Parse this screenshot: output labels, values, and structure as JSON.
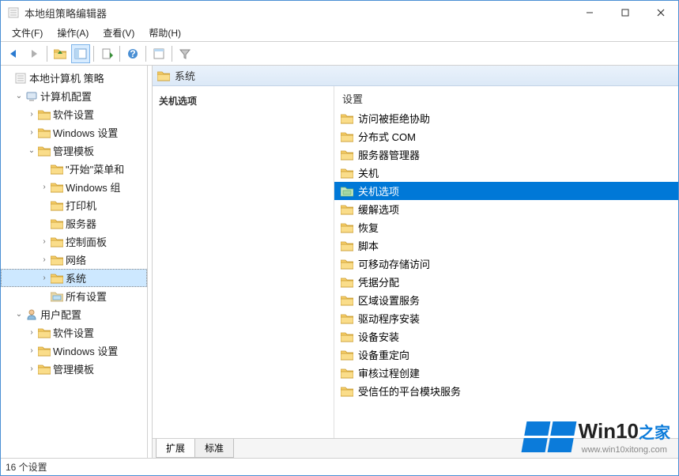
{
  "window": {
    "title": "本地组策略编辑器"
  },
  "menu": {
    "file": "文件(F)",
    "action": "操作(A)",
    "view": "查看(V)",
    "help": "帮助(H)"
  },
  "tree": {
    "root": "本地计算机 策略",
    "computer_config": "计算机配置",
    "cc_software": "软件设置",
    "cc_windows": "Windows 设置",
    "cc_admin": "管理模板",
    "at_start": "\"开始\"菜单和",
    "at_wincomp": "Windows 组",
    "at_printer": "打印机",
    "at_server": "服务器",
    "at_cpanel": "控制面板",
    "at_network": "网络",
    "at_system": "系统",
    "at_all": "所有设置",
    "user_config": "用户配置",
    "uc_software": "软件设置",
    "uc_windows": "Windows 设置",
    "uc_admin": "管理模板"
  },
  "content": {
    "header": "系统",
    "description": "关机选项",
    "column": "设置",
    "items": [
      "访问被拒绝协助",
      "分布式 COM",
      "服务器管理器",
      "关机",
      "关机选项",
      "缓解选项",
      "恢复",
      "脚本",
      "可移动存储访问",
      "凭据分配",
      "区域设置服务",
      "驱动程序安装",
      "设备安装",
      "设备重定向",
      "审核过程创建",
      "受信任的平台模块服务"
    ],
    "selected_index": 4
  },
  "tabs": {
    "extended": "扩展",
    "standard": "标准"
  },
  "status": {
    "text": "16 个设置"
  },
  "watermark": {
    "brand1": "Win10",
    "brand2": "之家",
    "url": "www.win10xitong.com"
  }
}
